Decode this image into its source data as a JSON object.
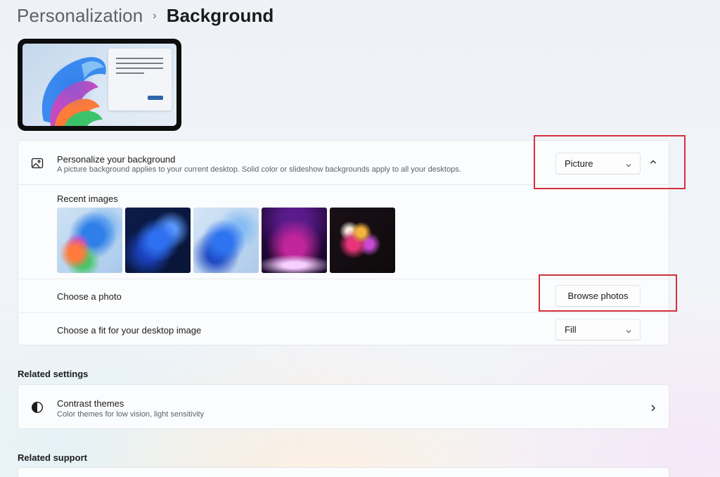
{
  "breadcrumb": {
    "parent": "Personalization",
    "separator": "›",
    "current": "Background"
  },
  "personalize": {
    "icon": "picture-icon",
    "title": "Personalize your background",
    "subtitle": "A picture background applies to your current desktop. Solid color or slideshow backgrounds apply to all your desktops.",
    "selected": "Picture"
  },
  "recent_images": {
    "label": "Recent images",
    "thumbnails": [
      "bloom-colorful",
      "bloom-dark-blue",
      "bloom-light-blue",
      "purple-glow",
      "abstract-ribbons"
    ]
  },
  "choose_photo": {
    "label": "Choose a photo",
    "button": "Browse photos"
  },
  "fit": {
    "label": "Choose a fit for your desktop image",
    "selected": "Fill"
  },
  "related_settings": {
    "header": "Related settings",
    "contrast": {
      "icon": "contrast-icon",
      "title": "Contrast themes",
      "subtitle": "Color themes for low vision, light sensitivity"
    }
  },
  "related_support": {
    "header": "Related support"
  },
  "colors": {
    "highlight": "#d1323d",
    "accent": "#2f64a8"
  }
}
